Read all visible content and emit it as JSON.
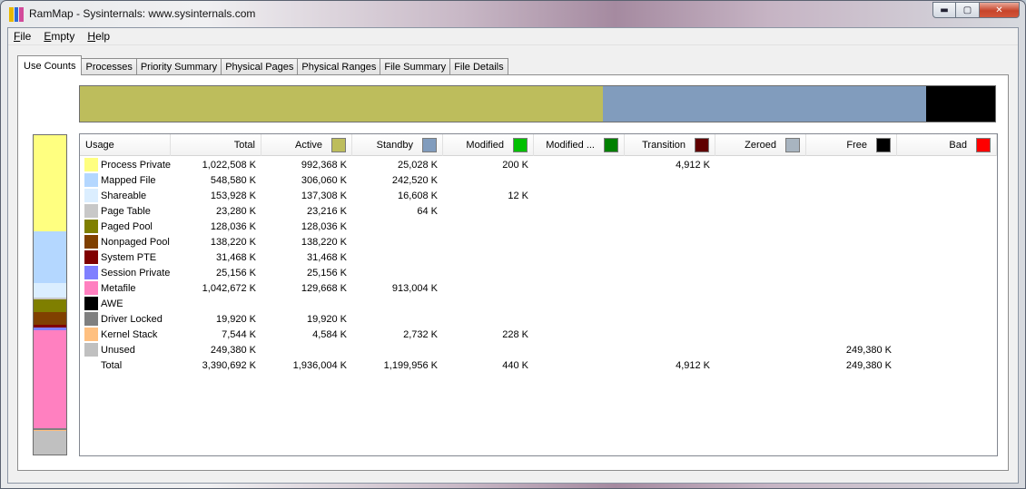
{
  "window": {
    "title": "RamMap - Sysinternals: www.sysinternals.com",
    "icon_colors": [
      "#e8b800",
      "#2c6bd4",
      "#d24a9a"
    ],
    "buttons": {
      "minimize": "▬",
      "maximize": "▢",
      "close": "✕"
    }
  },
  "menu": [
    {
      "key": "F",
      "rest": "ile"
    },
    {
      "key": "E",
      "rest": "mpty"
    },
    {
      "key": "H",
      "rest": "elp"
    }
  ],
  "tabs": [
    "Use Counts",
    "Processes",
    "Priority Summary",
    "Physical Pages",
    "Physical Ranges",
    "File Summary",
    "File Details"
  ],
  "active_tab": 0,
  "summary_bar": [
    {
      "label": "Active",
      "color": "#bdbd5c",
      "fraction": 0.571
    },
    {
      "label": "Standby",
      "color": "#819cbd",
      "fraction": 0.354
    },
    {
      "label": "Free",
      "color": "#000000",
      "fraction": 0.075
    }
  ],
  "usage_bar": [
    {
      "label": "Process Private",
      "color": "#ffff80",
      "fraction": 0.302
    },
    {
      "label": "Mapped File",
      "color": "#b4d7ff",
      "fraction": 0.162
    },
    {
      "label": "Shareable",
      "color": "#dbeeff",
      "fraction": 0.045
    },
    {
      "label": "Page Table",
      "color": "#c8c8c8",
      "fraction": 0.007
    },
    {
      "label": "Paged Pool",
      "color": "#7f7f00",
      "fraction": 0.038
    },
    {
      "label": "Nonpaged Pool",
      "color": "#804000",
      "fraction": 0.041
    },
    {
      "label": "System PTE",
      "color": "#800000",
      "fraction": 0.009
    },
    {
      "label": "Session Private",
      "color": "#8080ff",
      "fraction": 0.007
    },
    {
      "label": "Metafile",
      "color": "#ff80c0",
      "fraction": 0.308
    },
    {
      "label": "AWE",
      "color": "#000000",
      "fraction": 0.0
    },
    {
      "label": "Driver Locked",
      "color": "#808080",
      "fraction": 0.006
    },
    {
      "label": "Kernel Stack",
      "color": "#ffc080",
      "fraction": 0.002
    },
    {
      "label": "Unused",
      "color": "#c0c0c0",
      "fraction": 0.074
    }
  ],
  "columns": [
    {
      "label": "Usage",
      "align": "left",
      "swatch": null
    },
    {
      "label": "Total",
      "align": "right",
      "swatch": null
    },
    {
      "label": "Active",
      "align": "right",
      "swatch": "#bdbd5c"
    },
    {
      "label": "Standby",
      "align": "right",
      "swatch": "#819cbd"
    },
    {
      "label": "Modified",
      "align": "right",
      "swatch": "#00c000"
    },
    {
      "label": "Modified ...",
      "align": "right",
      "swatch": "#008000"
    },
    {
      "label": "Transition",
      "align": "right",
      "swatch": "#600000"
    },
    {
      "label": "Zeroed",
      "align": "right",
      "swatch": "#a8b4c0"
    },
    {
      "label": "Free",
      "align": "right",
      "swatch": "#000000"
    },
    {
      "label": "Bad",
      "align": "right",
      "swatch": "#ff0000"
    }
  ],
  "rows": [
    {
      "usage": "Process Private",
      "color": "#ffff80",
      "total": "1,022,508 K",
      "active": "992,368 K",
      "standby": "25,028 K",
      "modified": "200 K",
      "modified_nowrite": "",
      "transition": "4,912 K",
      "zeroed": "",
      "free": "",
      "bad": ""
    },
    {
      "usage": "Mapped File",
      "color": "#b4d7ff",
      "total": "548,580 K",
      "active": "306,060 K",
      "standby": "242,520 K",
      "modified": "",
      "modified_nowrite": "",
      "transition": "",
      "zeroed": "",
      "free": "",
      "bad": ""
    },
    {
      "usage": "Shareable",
      "color": "#dbeeff",
      "total": "153,928 K",
      "active": "137,308 K",
      "standby": "16,608 K",
      "modified": "12 K",
      "modified_nowrite": "",
      "transition": "",
      "zeroed": "",
      "free": "",
      "bad": ""
    },
    {
      "usage": "Page Table",
      "color": "#c8c8c8",
      "total": "23,280 K",
      "active": "23,216 K",
      "standby": "64 K",
      "modified": "",
      "modified_nowrite": "",
      "transition": "",
      "zeroed": "",
      "free": "",
      "bad": ""
    },
    {
      "usage": "Paged Pool",
      "color": "#7f7f00",
      "total": "128,036 K",
      "active": "128,036 K",
      "standby": "",
      "modified": "",
      "modified_nowrite": "",
      "transition": "",
      "zeroed": "",
      "free": "",
      "bad": ""
    },
    {
      "usage": "Nonpaged Pool",
      "color": "#804000",
      "total": "138,220 K",
      "active": "138,220 K",
      "standby": "",
      "modified": "",
      "modified_nowrite": "",
      "transition": "",
      "zeroed": "",
      "free": "",
      "bad": ""
    },
    {
      "usage": "System PTE",
      "color": "#800000",
      "total": "31,468 K",
      "active": "31,468 K",
      "standby": "",
      "modified": "",
      "modified_nowrite": "",
      "transition": "",
      "zeroed": "",
      "free": "",
      "bad": ""
    },
    {
      "usage": "Session Private",
      "color": "#8080ff",
      "total": "25,156 K",
      "active": "25,156 K",
      "standby": "",
      "modified": "",
      "modified_nowrite": "",
      "transition": "",
      "zeroed": "",
      "free": "",
      "bad": ""
    },
    {
      "usage": "Metafile",
      "color": "#ff80c0",
      "total": "1,042,672 K",
      "active": "129,668 K",
      "standby": "913,004 K",
      "modified": "",
      "modified_nowrite": "",
      "transition": "",
      "zeroed": "",
      "free": "",
      "bad": ""
    },
    {
      "usage": "AWE",
      "color": "#000000",
      "total": "",
      "active": "",
      "standby": "",
      "modified": "",
      "modified_nowrite": "",
      "transition": "",
      "zeroed": "",
      "free": "",
      "bad": ""
    },
    {
      "usage": "Driver Locked",
      "color": "#808080",
      "total": "19,920 K",
      "active": "19,920 K",
      "standby": "",
      "modified": "",
      "modified_nowrite": "",
      "transition": "",
      "zeroed": "",
      "free": "",
      "bad": ""
    },
    {
      "usage": "Kernel Stack",
      "color": "#ffc080",
      "total": "7,544 K",
      "active": "4,584 K",
      "standby": "2,732 K",
      "modified": "228 K",
      "modified_nowrite": "",
      "transition": "",
      "zeroed": "",
      "free": "",
      "bad": ""
    },
    {
      "usage": "Unused",
      "color": "#c0c0c0",
      "total": "249,380 K",
      "active": "",
      "standby": "",
      "modified": "",
      "modified_nowrite": "",
      "transition": "",
      "zeroed": "",
      "free": "249,380 K",
      "bad": ""
    },
    {
      "usage": "Total",
      "color": null,
      "total": "3,390,692 K",
      "active": "1,936,004 K",
      "standby": "1,199,956 K",
      "modified": "440 K",
      "modified_nowrite": "",
      "transition": "4,912 K",
      "zeroed": "",
      "free": "249,380 K",
      "bad": ""
    }
  ]
}
